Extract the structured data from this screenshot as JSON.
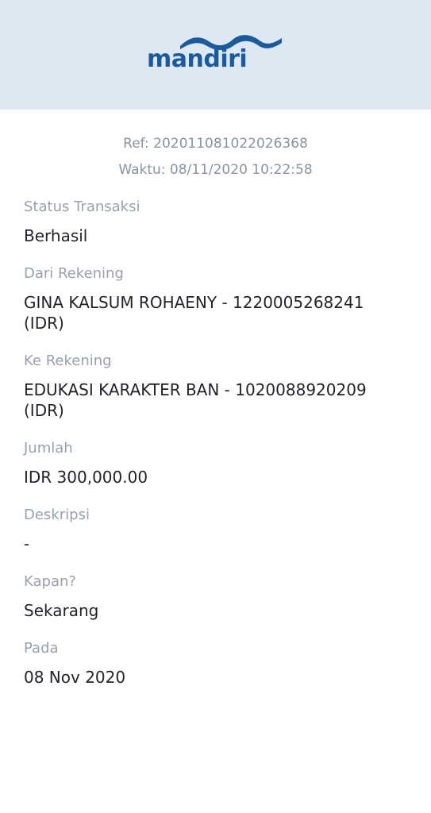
{
  "header": {
    "brand_name": "mandiri",
    "brand_color": "#1c5a9c",
    "background_color": "#dde8f3"
  },
  "receipt": {
    "ref": "Ref: 202011081022026368",
    "time": "Waktu: 08/11/2020 10:22:58"
  },
  "fields": [
    {
      "label": "Status Transaksi",
      "value": "Berhasil"
    },
    {
      "label": "Dari Rekening",
      "value": "GINA KALSUM ROHAENY - 1220005268241 (IDR)"
    },
    {
      "label": "Ke Rekening",
      "value": "EDUKASI KARAKTER BAN - 1020088920209 (IDR)"
    },
    {
      "label": "Jumlah",
      "value": "IDR 300,000.00"
    },
    {
      "label": "Deskripsi",
      "value": "-"
    },
    {
      "label": "Kapan?",
      "value": "Sekarang"
    },
    {
      "label": "Pada",
      "value": "08 Nov 2020"
    }
  ]
}
